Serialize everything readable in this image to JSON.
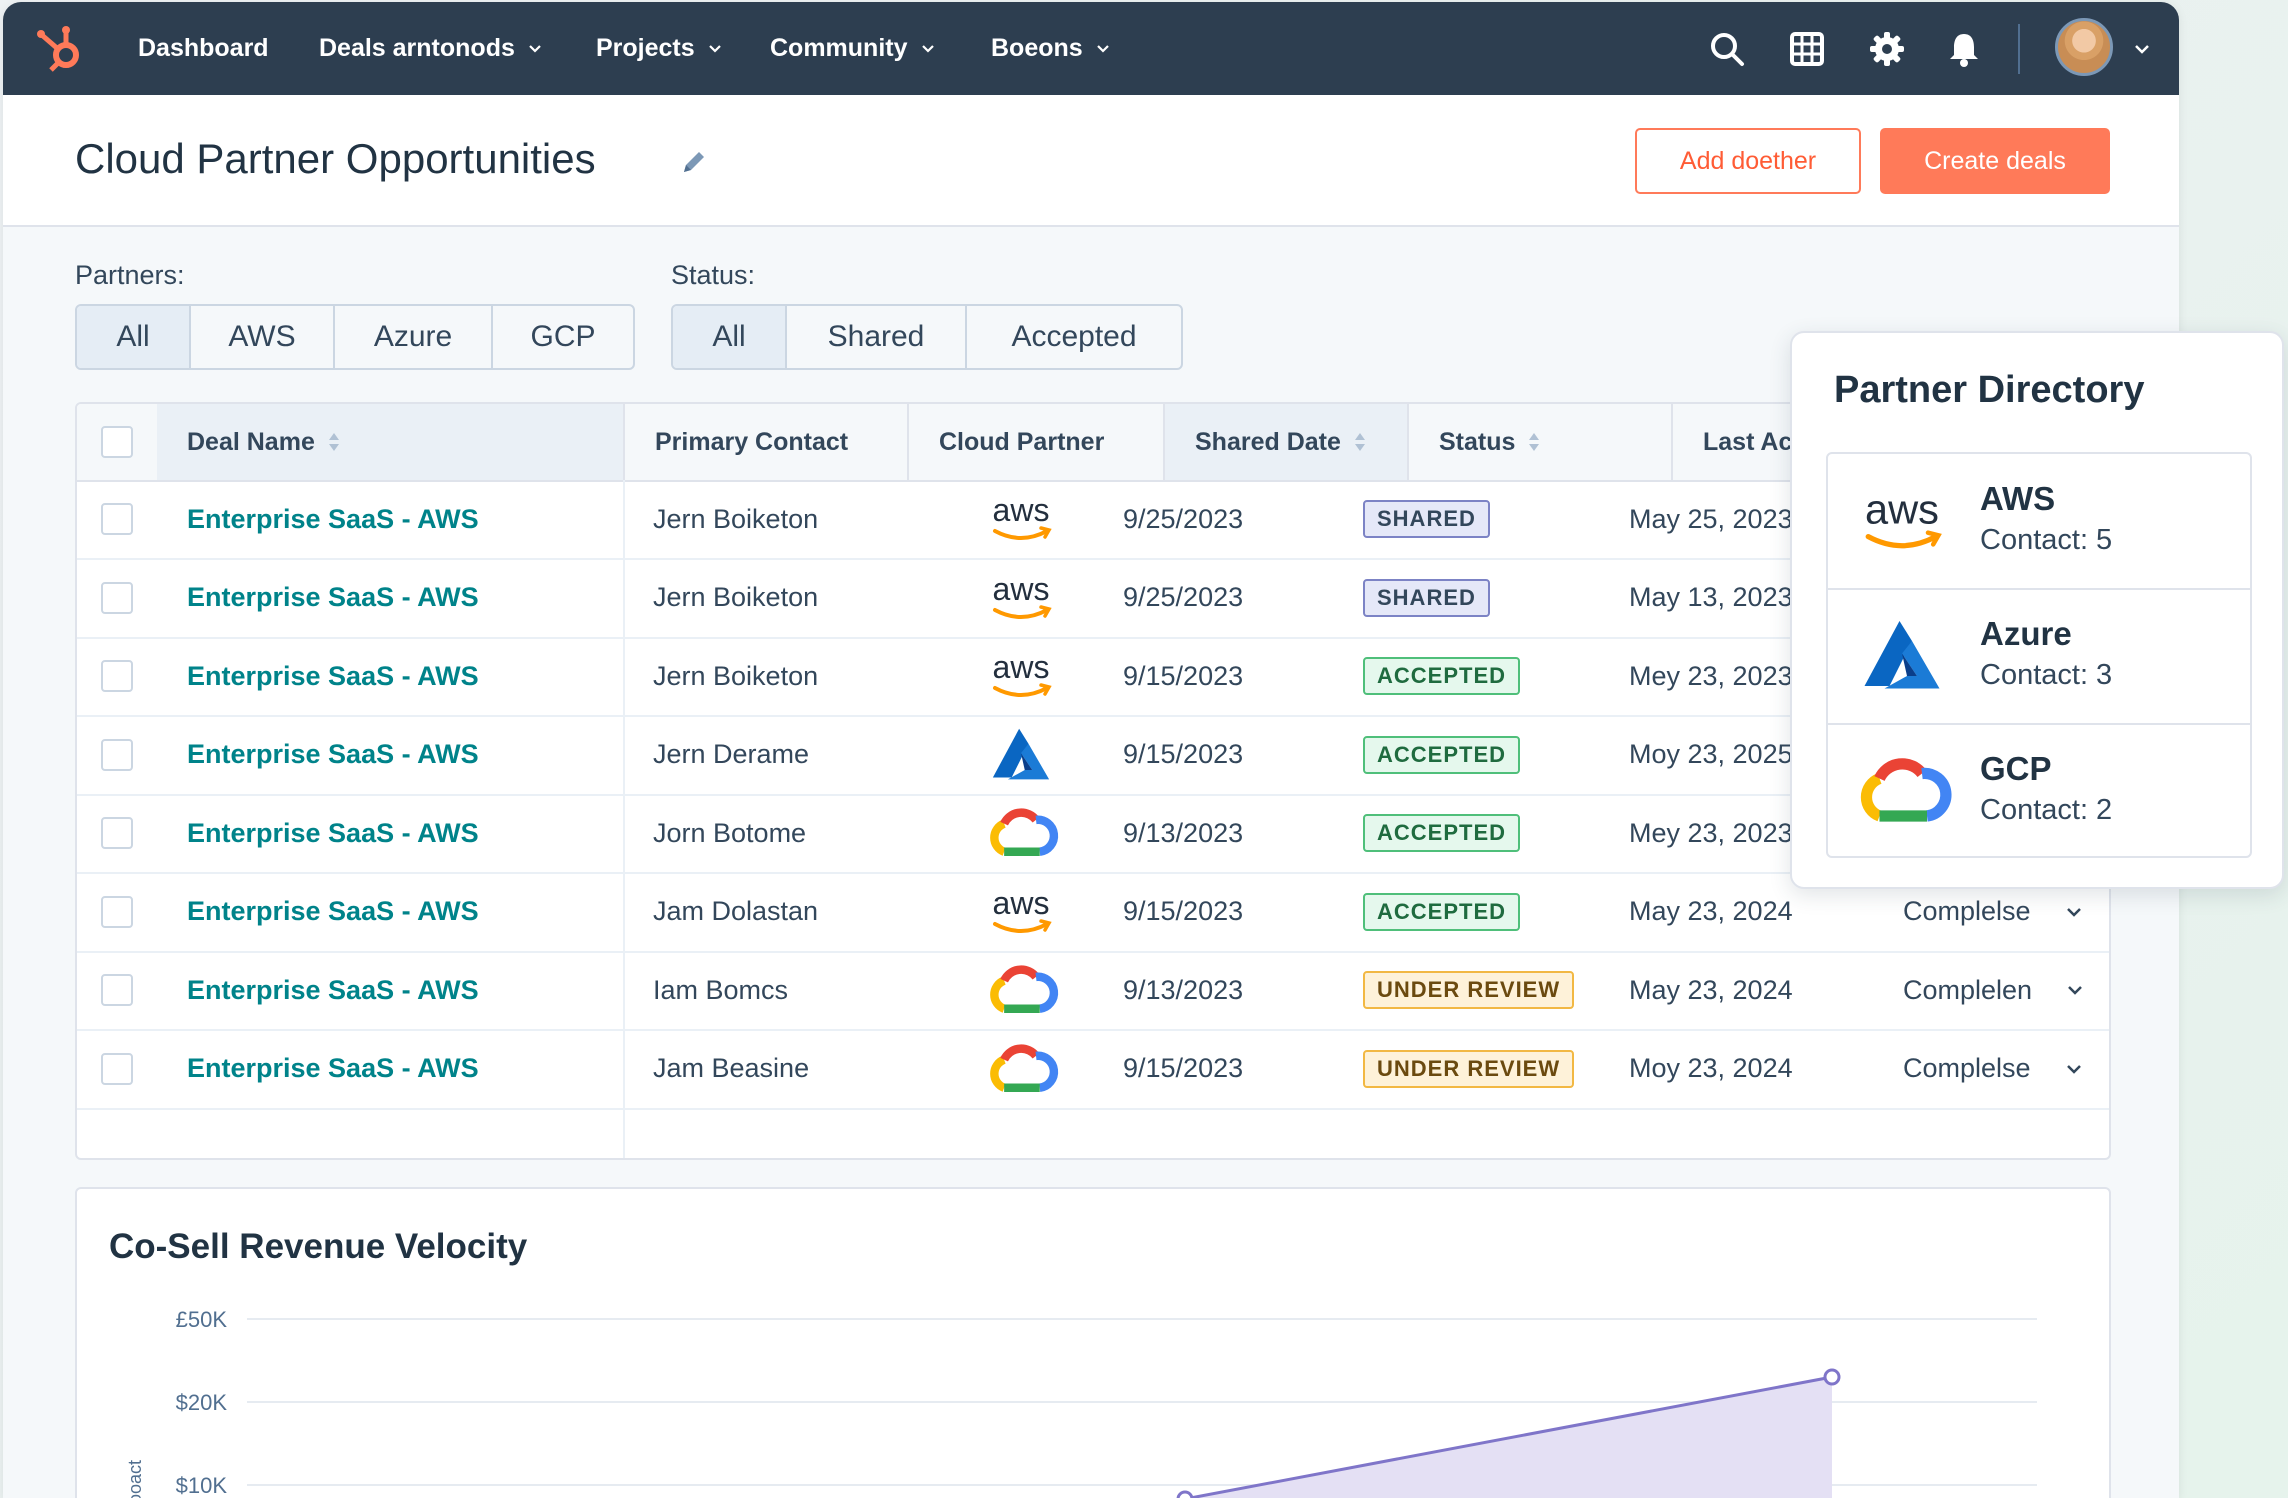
{
  "nav": {
    "items": [
      {
        "label": "Dashboard",
        "has_dropdown": false
      },
      {
        "label": "Deals arntonods",
        "has_dropdown": true
      },
      {
        "label": "Projects",
        "has_dropdown": true
      },
      {
        "label": "Community",
        "has_dropdown": true
      },
      {
        "label": "Boeons",
        "has_dropdown": true
      }
    ],
    "icons": [
      "search-icon",
      "grid-icon",
      "gear-icon",
      "bell-icon"
    ]
  },
  "header": {
    "title": "Cloud Partner Opportunities",
    "secondary_button": "Add doether",
    "primary_button": "Create deals"
  },
  "filters": {
    "partners_label": "Partners:",
    "partners": [
      "All",
      "AWS",
      "Azure",
      "GCP"
    ],
    "partners_active": "All",
    "status_label": "Status:",
    "status": [
      "All",
      "Shared",
      "Accepted"
    ],
    "status_active": "All"
  },
  "table": {
    "columns": [
      "Deal Name",
      "Primary Contact",
      "Cloud Partner",
      "Shared Date",
      "Status",
      "Last Activity"
    ],
    "rows": [
      {
        "deal": "Enterprise SaaS - AWS",
        "contact": "Jern Boiketon",
        "partner": "aws",
        "date": "9/25/2023",
        "status": "SHARED",
        "status_type": "shared",
        "activity": "May 25, 2023",
        "stage": ""
      },
      {
        "deal": "Enterprise SaaS - AWS",
        "contact": "Jern Boiketon",
        "partner": "aws",
        "date": "9/25/2023",
        "status": "SHARED",
        "status_type": "shared",
        "activity": "May 13, 2023",
        "stage": ""
      },
      {
        "deal": "Enterprise SaaS - AWS",
        "contact": "Jern Boiketon",
        "partner": "aws",
        "date": "9/15/2023",
        "status": "ACCEPTED",
        "status_type": "accepted",
        "activity": "Mey 23, 2023",
        "stage": ""
      },
      {
        "deal": "Enterprise SaaS - AWS",
        "contact": "Jern Derame",
        "partner": "azure",
        "date": "9/15/2023",
        "status": "ACCEPTED",
        "status_type": "accepted",
        "activity": "Moy 23, 2025",
        "stage": ""
      },
      {
        "deal": "Enterprise SaaS - AWS",
        "contact": "Jorn Botome",
        "partner": "gcp",
        "date": "9/13/2023",
        "status": "ACCEPTED",
        "status_type": "accepted",
        "activity": "Mey 23, 2023",
        "stage": ""
      },
      {
        "deal": "Enterprise SaaS - AWS",
        "contact": "Jam Dolastan",
        "partner": "aws",
        "date": "9/15/2023",
        "status": "ACCEPTED",
        "status_type": "accepted",
        "activity": "May 23, 2024",
        "stage": "Complelse"
      },
      {
        "deal": "Enterprise SaaS - AWS",
        "contact": "Iam Bomcs",
        "partner": "gcp",
        "date": "9/13/2023",
        "status": "UNDER REVIEW",
        "status_type": "review",
        "activity": "May 23, 2024",
        "stage": "Complelen"
      },
      {
        "deal": "Enterprise SaaS - AWS",
        "contact": "Jam Beasine",
        "partner": "gcp",
        "date": "9/15/2023",
        "status": "UNDER REVIEW",
        "status_type": "review",
        "activity": "Moy 23, 2024",
        "stage": "Complelse"
      }
    ]
  },
  "directory": {
    "title": "Partner Directory",
    "items": [
      {
        "name": "AWS",
        "contact": "Contact: 5",
        "logo": "aws"
      },
      {
        "name": "Azure",
        "contact": "Contact: 3",
        "logo": "azure"
      },
      {
        "name": "GCP",
        "contact": "Contact: 2",
        "logo": "gcp"
      }
    ]
  },
  "chart": {
    "title": "Co-Sell Revenue Velocity",
    "y_ticks": [
      "£50K",
      "$20K",
      "$10K"
    ],
    "ylabel": "ooact",
    "accent": "#7f75c9",
    "fill": "#e4e0f4"
  },
  "colors": {
    "nav_bg": "#2d3e50",
    "accent_orange": "#ff7a59",
    "link_teal": "#00838a"
  }
}
